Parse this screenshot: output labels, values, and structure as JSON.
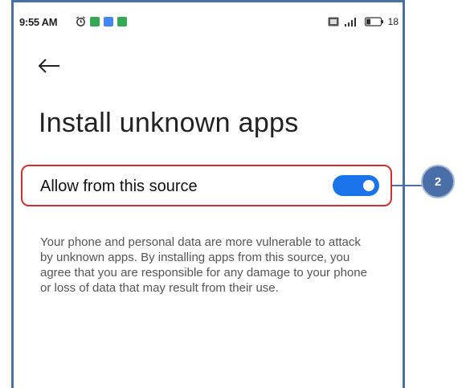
{
  "status_bar": {
    "time": "9:55 AM",
    "battery": "18",
    "icons_left": [
      "alarm-icon",
      "app-notification-icon",
      "app-notification-icon",
      "app-notification-icon"
    ],
    "icons_right": [
      "sim-icon",
      "signal-icon",
      "battery-icon"
    ]
  },
  "header": {
    "back_icon": "back-arrow-icon",
    "title": "Install unknown apps"
  },
  "setting": {
    "label": "Allow from this source",
    "enabled": true,
    "accent_color": "#1a73e8"
  },
  "description": "Your phone and personal data are more vulnerable to attack by unknown apps. By installing apps from this source, you agree that you are responsible for any damage to your phone or loss of data that may result from their use.",
  "callout": {
    "number": "2",
    "color": "#4a6ea8",
    "highlight_color": "#d32f2f"
  }
}
